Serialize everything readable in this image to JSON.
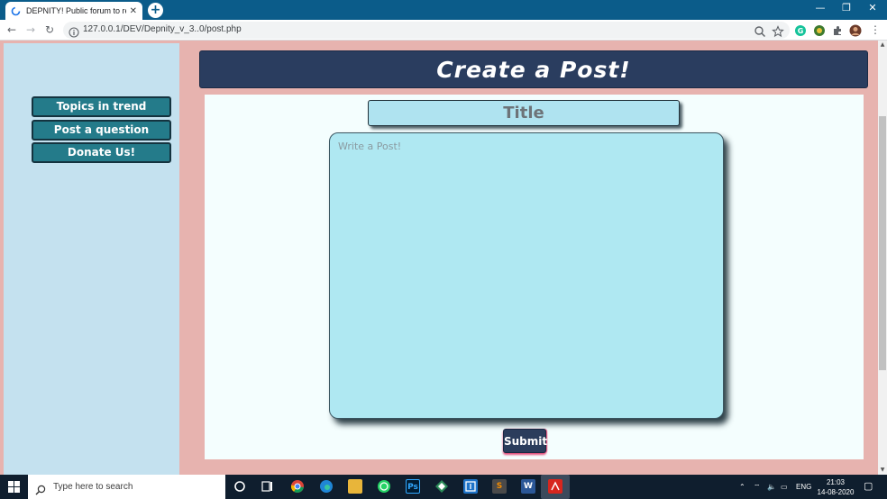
{
  "browser": {
    "tab_title": "DEPNITY! Public forum to resolve",
    "tab_close": "✕",
    "new_tab": "+",
    "url": "127.0.0.1/DEV/Depnity_v_3..0/post.php",
    "window_controls": {
      "minimize": "—",
      "restore": "❐",
      "close": "✕"
    },
    "nav": {
      "back": "←",
      "forward": "→",
      "reload": "↻"
    },
    "icons": [
      "search-icon",
      "star-icon",
      "grammarly-icon",
      "extension-icon",
      "puzzle-icon",
      "profile-avatar",
      "menu-icon"
    ]
  },
  "sidebar": {
    "items": [
      {
        "label": "Topics in trend"
      },
      {
        "label": "Post a question"
      },
      {
        "label": "Donate Us!"
      }
    ]
  },
  "header": {
    "title": "Create a Post!"
  },
  "form": {
    "title_placeholder": "Title",
    "post_placeholder": "Write a Post!",
    "submit_label": "Submit"
  },
  "taskbar": {
    "search_placeholder": "Type here to search",
    "apps": [
      "cortana-icon",
      "task-view-icon",
      "chrome-icon",
      "edge-icon",
      "file-explorer-icon",
      "whatsapp-icon",
      "photoshop-icon",
      "app-icon",
      "screenshot-app-icon",
      "sublime-icon",
      "word-icon",
      "acrobat-icon"
    ],
    "language": "ENG",
    "time": "21:03",
    "date": "14-08-2020"
  },
  "colors": {
    "page_background": "#e7b3af",
    "sidebar_background": "#c4e1ef",
    "sidebar_button": "#247b8a",
    "header_background": "#2a3d5f",
    "card_background": "#f4fefe",
    "input_background": "#afe3f0",
    "submit_background": "#2b3d5c"
  }
}
